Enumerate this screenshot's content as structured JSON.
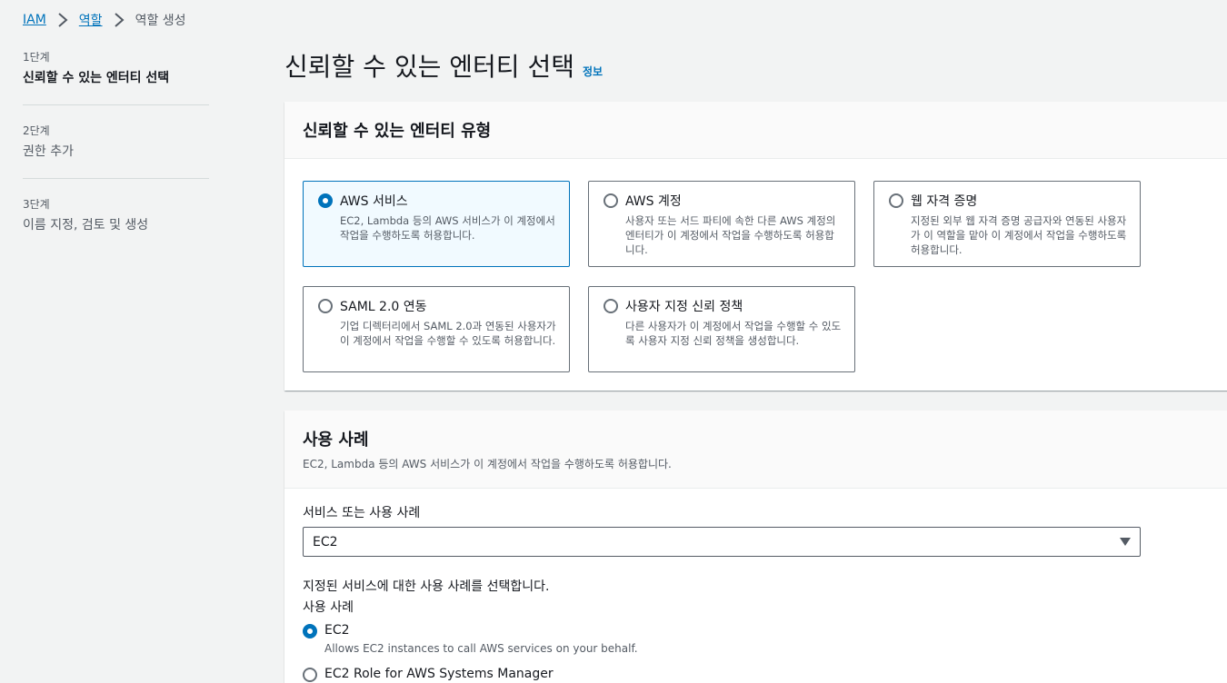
{
  "breadcrumb": {
    "items": [
      "IAM",
      "역할",
      "역할 생성"
    ]
  },
  "steps": [
    {
      "num": "1단계",
      "title": "신뢰할 수 있는 엔터티 선택"
    },
    {
      "num": "2단계",
      "title": "권한 추가"
    },
    {
      "num": "3단계",
      "title": "이름 지정, 검토 및 생성"
    }
  ],
  "page": {
    "title": "신뢰할 수 있는 엔터티 선택",
    "info": "정보"
  },
  "entity_panel": {
    "title": "신뢰할 수 있는 엔터티 유형",
    "options": [
      {
        "label": "AWS 서비스",
        "desc": "EC2, Lambda 등의 AWS 서비스가 이 계정에서 작업을 수행하도록 허용합니다.",
        "selected": true
      },
      {
        "label": "AWS 계정",
        "desc": "사용자 또는 서드 파티에 속한 다른 AWS 계정의 엔터티가 이 계정에서 작업을 수행하도록 허용합니다.",
        "selected": false
      },
      {
        "label": "웹 자격 증명",
        "desc": "지정된 외부 웹 자격 증명 공급자와 연동된 사용자가 이 역할을 맡아 이 계정에서 작업을 수행하도록 허용합니다.",
        "selected": false
      },
      {
        "label": "SAML 2.0 연동",
        "desc": "기업 디렉터리에서 SAML 2.0과 연동된 사용자가 이 계정에서 작업을 수행할 수 있도록 허용합니다.",
        "selected": false
      },
      {
        "label": "사용자 지정 신뢰 정책",
        "desc": "다른 사용자가 이 계정에서 작업을 수행할 수 있도록 사용자 지정 신뢰 정책을 생성합니다.",
        "selected": false
      }
    ]
  },
  "usecase_panel": {
    "title": "사용 사례",
    "desc": "EC2, Lambda 등의 AWS 서비스가 이 계정에서 작업을 수행하도록 허용합니다.",
    "service_label": "서비스 또는 사용 사례",
    "service_value": "EC2",
    "choose_text": "지정된 서비스에 대한 사용 사례를 선택합니다.",
    "usecase_label": "사용 사례",
    "usecases": [
      {
        "label": "EC2",
        "desc": "Allows EC2 instances to call AWS services on your behalf.",
        "selected": true
      },
      {
        "label": "EC2 Role for AWS Systems Manager",
        "desc": "",
        "selected": false
      }
    ]
  },
  "colors": {
    "accent": "#0073bb",
    "background": "#f2f3f3",
    "selected_tile_bg": "#f1faff"
  }
}
